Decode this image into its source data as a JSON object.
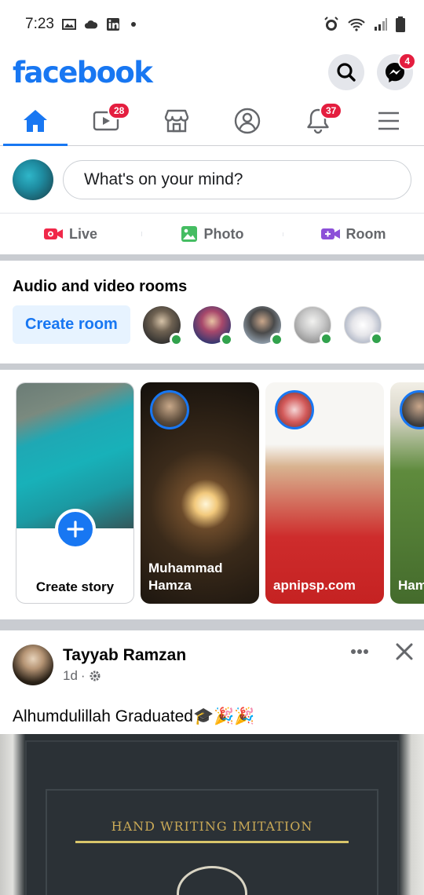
{
  "status_bar": {
    "time": "7:23"
  },
  "header": {
    "logo": "facebook",
    "messenger_badge": "4"
  },
  "nav": {
    "watch_badge": "28",
    "notifications_badge": "37"
  },
  "composer": {
    "placeholder": "What's on your mind?"
  },
  "actions": {
    "live": "Live",
    "photo": "Photo",
    "room": "Room"
  },
  "rooms": {
    "title": "Audio and video rooms",
    "create_label": "Create room"
  },
  "stories": {
    "create_label": "Create story",
    "items": [
      {
        "name_line1": "Muhammad",
        "name_line2": "Hamza"
      },
      {
        "name_line1": "apnipsp.com",
        "name_line2": ""
      },
      {
        "name_line1": "Ham",
        "name_line2": ""
      }
    ]
  },
  "post": {
    "author": "Tayyab Ramzan",
    "time": "1d",
    "text": "Alhumdulillah Graduated🎓🎉🎉",
    "image_title": "HAND WRITING IMITATION"
  },
  "colors": {
    "brand": "#1877f2",
    "badge": "#e41e3f",
    "online": "#31a24c"
  }
}
